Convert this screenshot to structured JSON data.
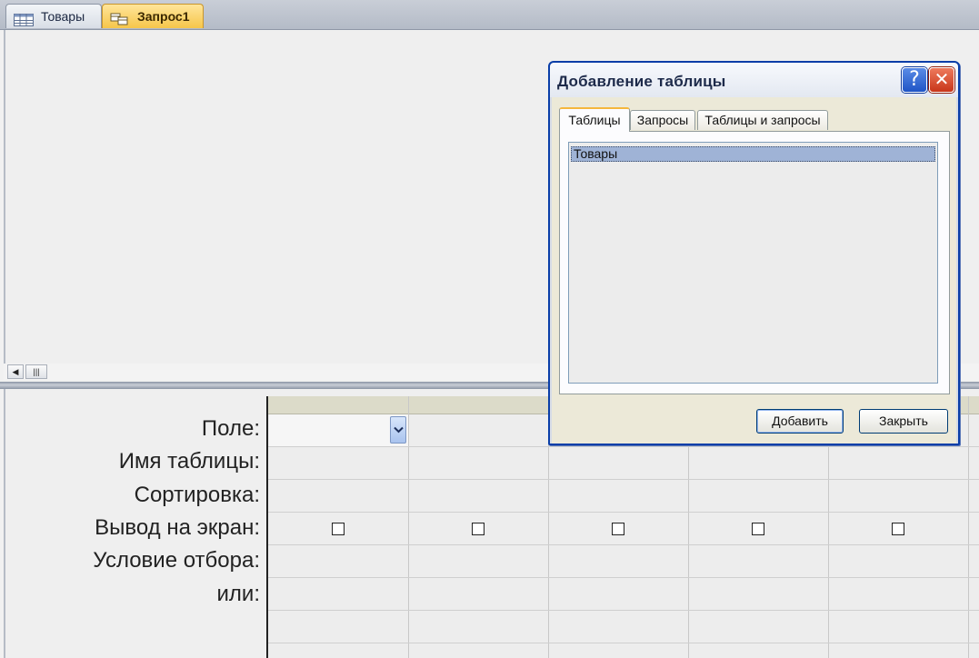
{
  "doc_tabs": [
    {
      "label": "Товары",
      "icon": "table-icon",
      "active": false
    },
    {
      "label": "Запрос1",
      "icon": "query-icon",
      "active": true
    }
  ],
  "grid": {
    "row_labels": [
      "Поле:",
      "Имя таблицы:",
      "Сортировка:",
      "Вывод на экран:",
      "Условие отбора:",
      "или:"
    ],
    "field_dropdown_icon": "chevron-down-icon",
    "show_checkboxes": [
      false,
      false,
      false,
      false,
      false
    ]
  },
  "dialog": {
    "title": "Добавление таблицы",
    "help_label": "?",
    "close_label": "✕",
    "tabs": [
      "Таблицы",
      "Запросы",
      "Таблицы и запросы"
    ],
    "active_tab": "Таблицы",
    "list_items": [
      "Товары"
    ],
    "selected_item": "Товары",
    "add_button": "Добавить",
    "close_button": "Закрыть"
  },
  "colors": {
    "active_tab": "#f6c64a",
    "dialog_border": "#0a3ea8",
    "selection": "#9fb3d6"
  }
}
